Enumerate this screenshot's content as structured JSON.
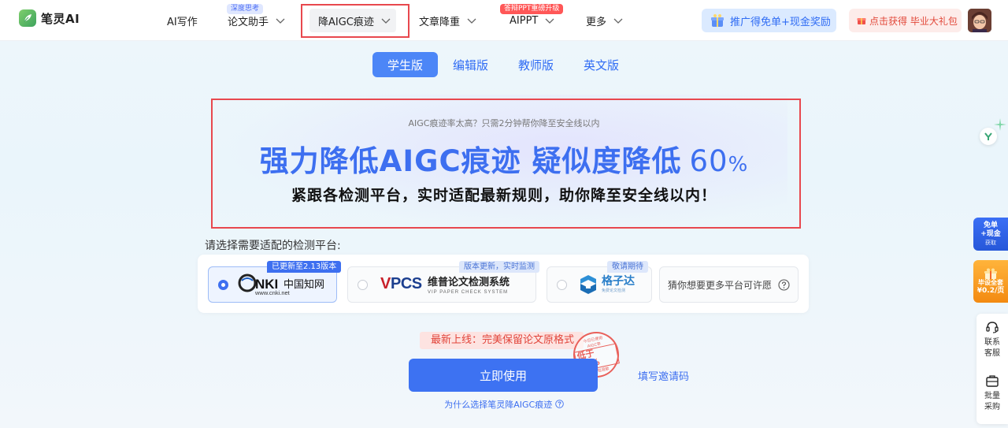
{
  "app": {
    "name": "笔灵AI"
  },
  "nav": {
    "items": [
      {
        "label": "AI写作"
      },
      {
        "label": "论文助手",
        "badge": "深度思考"
      },
      {
        "label": "降AIGC痕迹"
      },
      {
        "label": "文章降重"
      },
      {
        "label": "AIPPT",
        "badge": "答辩PPT重磅升级"
      },
      {
        "label": "更多"
      }
    ],
    "promo": "推广得免单+现金奖励",
    "gift": "点击获得 毕业大礼包"
  },
  "tabs": [
    {
      "label": "学生版",
      "active": true
    },
    {
      "label": "编辑版",
      "active": false
    },
    {
      "label": "教师版",
      "active": false
    },
    {
      "label": "英文版",
      "active": false
    }
  ],
  "hero": {
    "subtitle": "AIGC痕迹率太高？只需2分钟帮你降至安全线以内",
    "title_main": "强力降低AIGC痕迹 疑似度降低",
    "title_number": "60",
    "title_unit": "%",
    "description": "紧跟各检测平台，实时适配最新规则，助你降至安全线以内！"
  },
  "platforms": {
    "label": "请选择需要适配的检测平台:",
    "cards": [
      {
        "tag": "已更新至2.13版本",
        "logo_text": "CNKI中国知网",
        "url": "www.cnki.net",
        "selected": true
      },
      {
        "tag": "版本更新，实时监测",
        "logo_text": "VPCS",
        "name": "维普论文检测系统",
        "sub": "VIP PAPER CHECK SYSTEM",
        "selected": false
      },
      {
        "tag": "敬请期待",
        "name": "格子达",
        "sub": "免费论文检测",
        "selected": false
      }
    ],
    "more": "猜你想要更多平台可许愿"
  },
  "cta": {
    "new_online": "最新上线：完美保留论文原格式",
    "stamp": {
      "top": "今日已使用",
      "mid": "AIGC率",
      "value": "低于25%",
      "bottom": "不过包退款"
    },
    "use_button": "立即使用",
    "invite_link": "填写邀请码",
    "why_link": "为什么选择笔灵降AIGC痕迹"
  },
  "side": {
    "free_line1": "免单",
    "free_line2": "+现金",
    "free_line3": "获取",
    "bz_line1": "毕设全套",
    "bz_line2": "¥0.2/页",
    "contact": "联系客服",
    "batch": "批量采购"
  },
  "colors": {
    "accent": "#3d6ff0",
    "annotation": "#e8484e",
    "hot_badge": "#ff5757"
  }
}
